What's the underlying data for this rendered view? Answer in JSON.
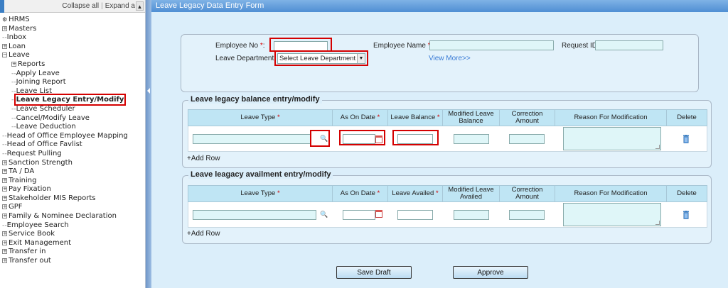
{
  "sidebar": {
    "collapse_all": "Collapse all",
    "expand_all": "Expand a",
    "tree": [
      {
        "label": "HRMS",
        "indent": 0,
        "toggle": "root"
      },
      {
        "label": "Masters",
        "indent": 0,
        "toggle": "+"
      },
      {
        "label": "Inbox",
        "indent": 0,
        "toggle": "-"
      },
      {
        "label": "Loan",
        "indent": 0,
        "toggle": "+"
      },
      {
        "label": "Leave",
        "indent": 0,
        "toggle": "minus"
      },
      {
        "label": "Reports",
        "indent": 1,
        "toggle": "+"
      },
      {
        "label": "Apply Leave",
        "indent": 1,
        "toggle": "-"
      },
      {
        "label": "Joining Report",
        "indent": 1,
        "toggle": "-"
      },
      {
        "label": "Leave List",
        "indent": 1,
        "toggle": "-"
      },
      {
        "label": "Leave Legacy Entry/Modify",
        "indent": 1,
        "toggle": "-",
        "highlighted": true
      },
      {
        "label": "Leave Scheduler",
        "indent": 1,
        "toggle": "-"
      },
      {
        "label": "Cancel/Modify Leave",
        "indent": 1,
        "toggle": "-"
      },
      {
        "label": "Leave Deduction",
        "indent": 1,
        "toggle": "-"
      },
      {
        "label": "Head of Office Employee Mapping",
        "indent": 0,
        "toggle": "-"
      },
      {
        "label": "Head of Office Favlist",
        "indent": 0,
        "toggle": "-"
      },
      {
        "label": "Request Pulling",
        "indent": 0,
        "toggle": "-"
      },
      {
        "label": "Sanction Strength",
        "indent": 0,
        "toggle": "+"
      },
      {
        "label": "TA / DA",
        "indent": 0,
        "toggle": "+"
      },
      {
        "label": "Training",
        "indent": 0,
        "toggle": "+"
      },
      {
        "label": "Pay Fixation",
        "indent": 0,
        "toggle": "+"
      },
      {
        "label": "Stakeholder MIS Reports",
        "indent": 0,
        "toggle": "+"
      },
      {
        "label": "GPF",
        "indent": 0,
        "toggle": "+"
      },
      {
        "label": "Family & Nominee Declaration",
        "indent": 0,
        "toggle": "+"
      },
      {
        "label": "Employee Search",
        "indent": 0,
        "toggle": "-"
      },
      {
        "label": "Service Book",
        "indent": 0,
        "toggle": "+"
      },
      {
        "label": "Exit Management",
        "indent": 0,
        "toggle": "+"
      },
      {
        "label": "Transfer in",
        "indent": 0,
        "toggle": "+"
      },
      {
        "label": "Transfer out",
        "indent": 0,
        "toggle": "+"
      }
    ]
  },
  "form": {
    "title": "Leave Legacy Data Entry Form",
    "employee_no_label": "Employee No",
    "employee_no_value": "",
    "employee_name_label": "Employee Name",
    "employee_name_value": "",
    "request_id_label": "Request ID",
    "request_id_value": "",
    "leave_department_label": "Leave Department:",
    "leave_department_value": "Select Leave Department",
    "view_more": "View More>>",
    "required_marker": "*"
  },
  "balance_section": {
    "legend": "Leave legacy balance entry/modify",
    "columns": [
      "Leave Type",
      "As On Date",
      "Leave Balance",
      "Modified Leave Balance",
      "Correction Amount",
      "Reason For Modification",
      "Delete"
    ],
    "add_row": "+Add Row"
  },
  "availment_section": {
    "legend": "Leave leagacy availment entry/modify",
    "columns": [
      "Leave Type",
      "As On Date",
      "Leave Availed",
      "Modified Leave Availed",
      "Correction Amount",
      "Reason For Modification",
      "Delete"
    ],
    "add_row": "+Add Row"
  },
  "buttons": {
    "save_draft": "Save Draft",
    "approve": "Approve"
  },
  "icons": {
    "search": "search-icon",
    "calendar": "calendar-icon",
    "delete": "trash-icon"
  },
  "colors": {
    "title_bar": "#5b98d8",
    "highlight": "#d40000",
    "panel": "#dbeefa",
    "grid_header": "#bfe5f4",
    "input_fill": "#dff6f8",
    "trash": "#3b7fc4"
  }
}
